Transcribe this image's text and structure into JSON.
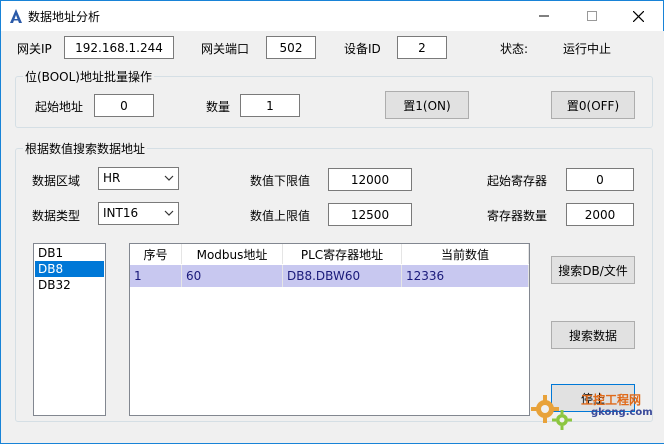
{
  "window": {
    "title": "数据地址分析",
    "controls": {
      "minimize": "—",
      "maximize": "☐",
      "close": "✕"
    }
  },
  "connection": {
    "gateway_ip_label": "网关IP",
    "gateway_ip_value": "192.168.1.244",
    "gateway_port_label": "网关端口",
    "gateway_port_value": "502",
    "device_id_label": "设备ID",
    "device_id_value": "2",
    "status_label": "状态:",
    "status_value": "运行中止"
  },
  "bool_group": {
    "title": "位(BOOL)地址批量操作",
    "start_label": "起始地址",
    "start_value": "0",
    "count_label": "数量",
    "count_value": "1",
    "set1_button": "置1(ON)",
    "set0_button": "置0(OFF)"
  },
  "search_group": {
    "title": "根据数值搜索数据地址",
    "area_label": "数据区域",
    "area_value": "HR",
    "type_label": "数据类型",
    "type_value": "INT16",
    "lower_label": "数值下限值",
    "lower_value": "12000",
    "upper_label": "数值上限值",
    "upper_value": "12500",
    "start_reg_label": "起始寄存器",
    "start_reg_value": "0",
    "reg_count_label": "寄存器数量",
    "reg_count_value": "2000",
    "db_list": [
      "DB1",
      "DB8",
      "DB32"
    ],
    "selected_db_index": 1,
    "table": {
      "columns": [
        "序号",
        "Modbus地址",
        "PLC寄存器地址",
        "当前数值"
      ],
      "rows": [
        [
          "1",
          "60",
          "DB8.DBW60",
          "12336"
        ]
      ]
    },
    "search_db_button": "搜索DB/文件",
    "search_data_button": "搜索数据",
    "partial_button": "停止"
  },
  "watermark": {
    "line1": "工控工程网",
    "line2": "gkong.com"
  },
  "colors": {
    "accent": "#0078d7",
    "selected_row": "#c8c8f0",
    "window_bg": "#f0f0f0"
  }
}
